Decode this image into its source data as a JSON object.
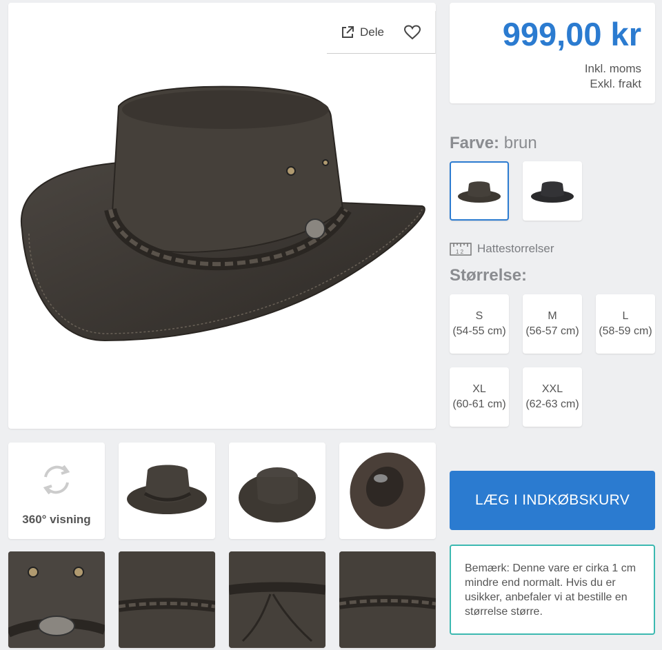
{
  "share": {
    "label": "Dele"
  },
  "price": {
    "amount": "999,00 kr",
    "vat": "Inkl. moms",
    "freight": "Exkl. frakt"
  },
  "color": {
    "label": "Farve:",
    "value": "brun"
  },
  "size_guide": {
    "label": "Hattestorrelser"
  },
  "size": {
    "label": "Størrelse:",
    "options": [
      {
        "name": "S",
        "range": "(54-55 cm)"
      },
      {
        "name": "M",
        "range": "(56-57 cm)"
      },
      {
        "name": "L",
        "range": "(58-59 cm)"
      },
      {
        "name": "XL",
        "range": "(60-61 cm)"
      },
      {
        "name": "XXL",
        "range": "(62-63 cm)"
      }
    ]
  },
  "view360": {
    "label": "360° visning"
  },
  "cart": {
    "label": "LÆG I INDKØBSKURV"
  },
  "note": {
    "text": "Bemærk: Denne vare er cirka 1 cm mindre end normalt. Hvis du er usikker, anbefaler vi at bestille en størrelse større."
  },
  "colors": {
    "accent": "#2b7bd0",
    "note_border": "#3bb8b0",
    "hat": "#3d3832"
  },
  "icons": [
    "share-icon",
    "heart-icon",
    "ruler-icon",
    "rotate-360-icon"
  ]
}
